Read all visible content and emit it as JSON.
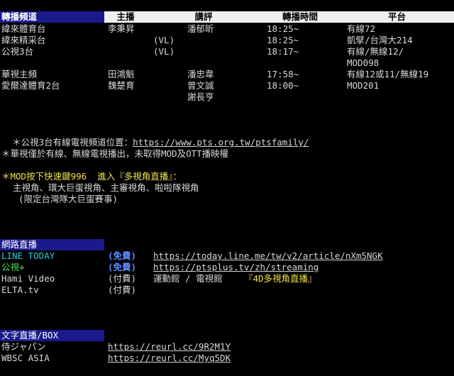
{
  "schedule": {
    "headers": {
      "channel": "轉播頻道",
      "host": "主播",
      "commentary": "講評",
      "time": "轉播時間",
      "platform": "平台"
    },
    "rows": [
      {
        "channel": "緯來體育台",
        "host": "李秉昇",
        "commentary": "潘郁昕",
        "time": "18:25~",
        "platform": "有線72"
      },
      {
        "channel": "緯來精采台",
        "host": "(VL)",
        "commentary": "",
        "time": "18:25~",
        "platform": "凱擘/台灣大214"
      },
      {
        "channel": "公視3台",
        "host": "(VL)",
        "commentary": "",
        "time": "18:17~",
        "platform": "有線/無線12/"
      },
      {
        "channel": "",
        "host": "",
        "commentary": "",
        "time": "",
        "platform": "MOD098"
      },
      {
        "channel": "華視主頻",
        "host": "田鴻魁",
        "commentary": "潘忠韋",
        "time": "17:58~",
        "platform": "有線12或11/無線19"
      },
      {
        "channel": "愛爾達體育2台",
        "host": "魏楚育",
        "commentary": "曾文誠",
        "time": "18:00~",
        "platform": "MOD201"
      },
      {
        "channel": "",
        "host": "",
        "commentary": "謝長亨",
        "time": "",
        "platform": ""
      }
    ]
  },
  "notes": {
    "pts_prefix": "＊公視3台有線電視頻道位置：",
    "pts_link": "https://www.pts.org.tw/ptsfamily/",
    "cts": "＊華視僅於有線、無線電視播出，未取得MOD及OTT播映權",
    "mod_line": "＊MOD按下快速鍵996  進入『多視角直播』：",
    "mod_sub1": "主視角、環大巨蛋視角、主審視角、啦啦隊視角",
    "mod_sub2": "(限定台灣隊大巨蛋賽事)"
  },
  "online": {
    "title": "網路直播",
    "items": [
      {
        "name": "LINE TODAY",
        "price": "(免費)",
        "link": "https://today.line.me/tw/v2/article/nXm5NGK"
      },
      {
        "name": "公視+",
        "price": "(免費)",
        "link": "https://ptsplus.tv/zh/streaming"
      },
      {
        "name": "Hami Video",
        "price": "(付費)",
        "link": "運動館 / 電視館",
        "extra": "『4D多視角直播』"
      },
      {
        "name": "ELTA.tv",
        "price": "(付費)",
        "link": ""
      }
    ]
  },
  "text_live": {
    "title": "文字直播/BOX",
    "items": [
      {
        "name": "侍ジャパン",
        "link": "https://reurl.cc/9R2M1Y"
      },
      {
        "name": "WBSC ASIA",
        "link": "https://reurl.cc/Myq5DK"
      }
    ]
  }
}
